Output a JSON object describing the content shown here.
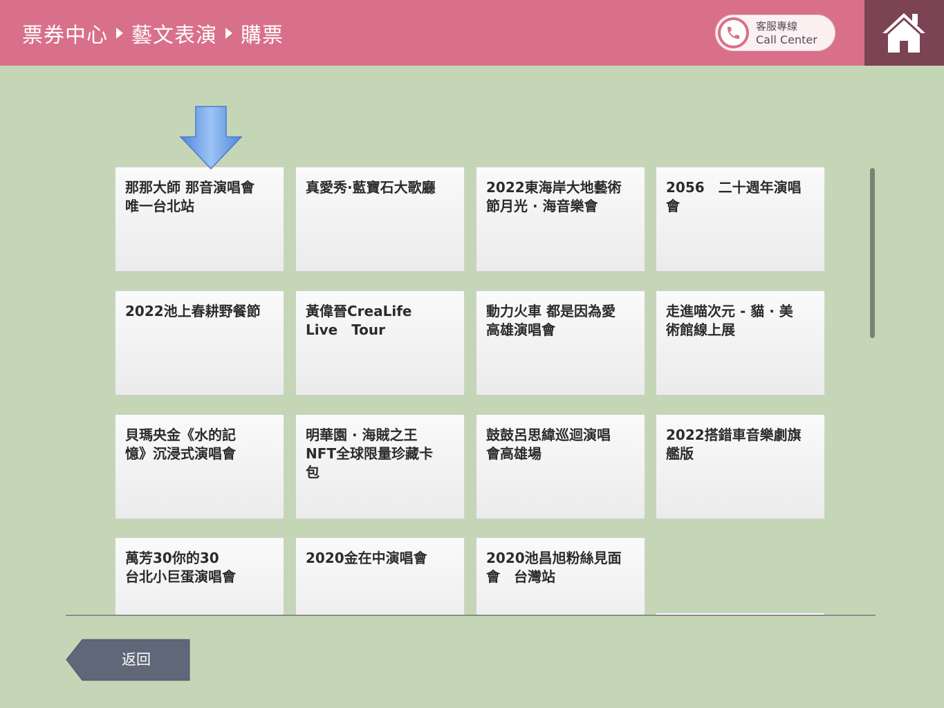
{
  "header": {
    "breadcrumb": [
      "票券中心",
      "藝文表演",
      "購票"
    ],
    "call_center": {
      "line1": "客服專線",
      "line2": "Call Center"
    }
  },
  "tiles": [
    {
      "text": "那那大師 那音演唱會\n唯一台北站"
    },
    {
      "text": "真愛秀·藍寶石大歌廳"
    },
    {
      "text": "2022東海岸大地藝術\n節月光 · 海音樂會"
    },
    {
      "text": "2056　二十週年演唱\n會"
    },
    {
      "text": "2022池上春耕野餐節"
    },
    {
      "text": "黃偉晉CreaLife\nLive　Tour"
    },
    {
      "text": "動力火車 都是因為愛\n高雄演唱會"
    },
    {
      "text": "走進喵次元 - 貓 · 美\n術館線上展"
    },
    {
      "text": "貝瑪央金《水的記\n憶》沉浸式演唱會"
    },
    {
      "text": "明華園 · 海賊之王\nNFT全球限量珍藏卡\n包"
    },
    {
      "text": "鼓鼓呂思緯巡迴演唱\n會高雄場"
    },
    {
      "text": "2022搭錯車音樂劇旗\n艦版"
    },
    {
      "text": "萬芳30你的30\n台北小巨蛋演唱會"
    },
    {
      "text": "2020金在中演唱會"
    },
    {
      "text": "2020池昌旭粉絲見面\n會　台灣站"
    },
    {
      "text": ""
    }
  ],
  "footer": {
    "back_label": "返回"
  },
  "colors": {
    "header_bg": "#d97089",
    "home_bg": "#7b4353",
    "page_bg": "#c5d6b7",
    "arrow": "#6fa3e8",
    "back_btn": "#5f6778"
  }
}
